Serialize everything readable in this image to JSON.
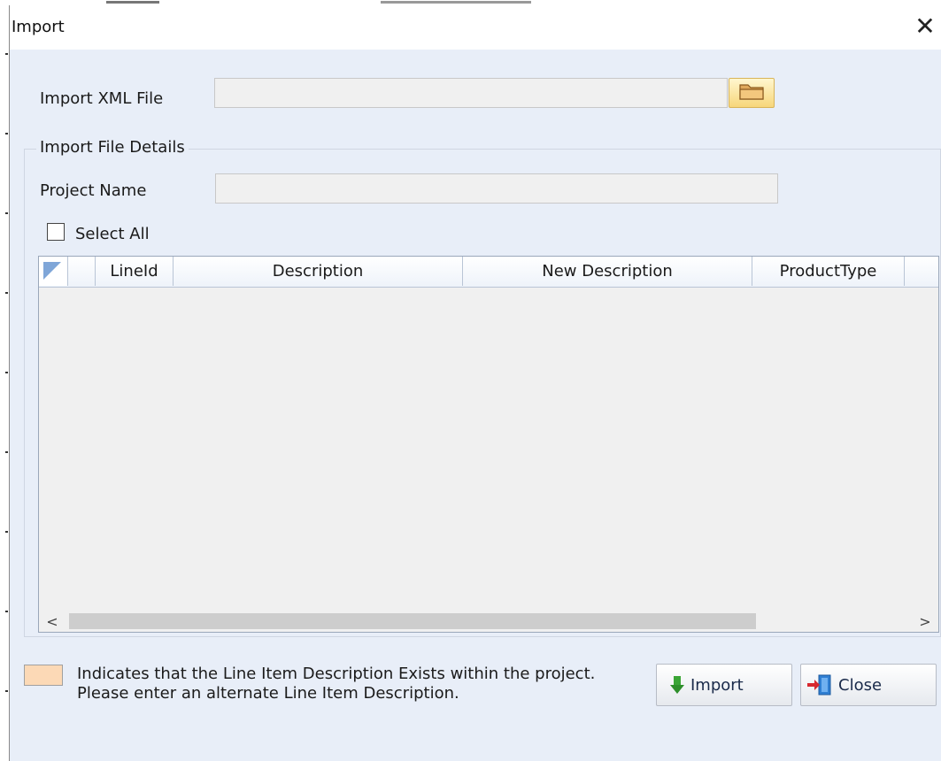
{
  "dialog": {
    "title": "Import",
    "close_glyph": "✕"
  },
  "import_file": {
    "label": "Import XML File",
    "value": "",
    "browse_icon": "folder-icon"
  },
  "details": {
    "group_label": "Import File Details",
    "project_name_label": "Project Name",
    "project_name_value": "",
    "select_all_label": "Select All",
    "select_all_checked": false
  },
  "grid": {
    "columns": [
      "LineId",
      "Description",
      "New Description",
      "ProductType"
    ],
    "rows": [],
    "scroll_left": "<",
    "scroll_right": ">"
  },
  "legend": {
    "swatch_color": "#fcd9b6",
    "text": "Indicates that the Line Item Description Exists within the project. Please enter an alternate Line Item Description."
  },
  "buttons": {
    "import_label": "Import",
    "import_icon": "download-arrow-icon",
    "close_label": "Close",
    "close_icon": "exit-door-icon"
  }
}
